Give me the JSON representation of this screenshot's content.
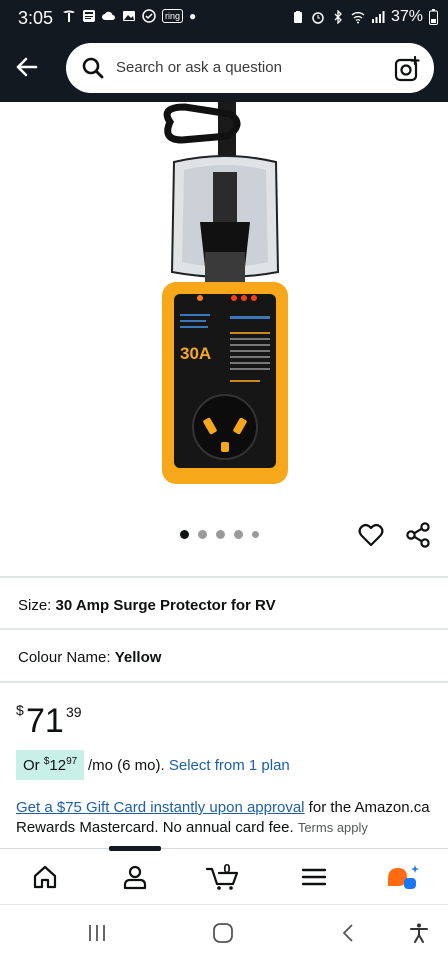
{
  "status_bar": {
    "time": "3:05",
    "ring_label": "ring",
    "battery": "37%"
  },
  "header": {
    "search_placeholder": "Search or ask a question"
  },
  "product_image": {
    "label_30a": "30A"
  },
  "carousel": {
    "count": 5,
    "active_index": 0
  },
  "size": {
    "label": "Size:",
    "value": "30 Amp Surge Protector for RV"
  },
  "colour": {
    "label": "Colour Name:",
    "value": "Yellow"
  },
  "price": {
    "currency": "$",
    "whole": "71",
    "fraction": "39"
  },
  "monthly": {
    "prefix": "Or",
    "currency": "$",
    "whole": "12",
    "fraction": "97",
    "suffix": "/mo (6 mo).",
    "link": "Select from 1 plan"
  },
  "gift": {
    "link": "Get a $75 Gift Card instantly upon approval",
    "text": " for the Amazon.ca Rewards Mastercard. No annual card fee. ",
    "terms": "Terms apply"
  },
  "bottom_nav": {
    "cart_count": "0",
    "active_tab": "account"
  },
  "colors": {
    "header_bg": "#131921",
    "link": "#1d5ea7",
    "monthly_highlight": "#c9f0e6",
    "product_yellow": "#f6a81a",
    "rufus_orange": "#ff6a13",
    "rufus_blue": "#1877f2"
  }
}
